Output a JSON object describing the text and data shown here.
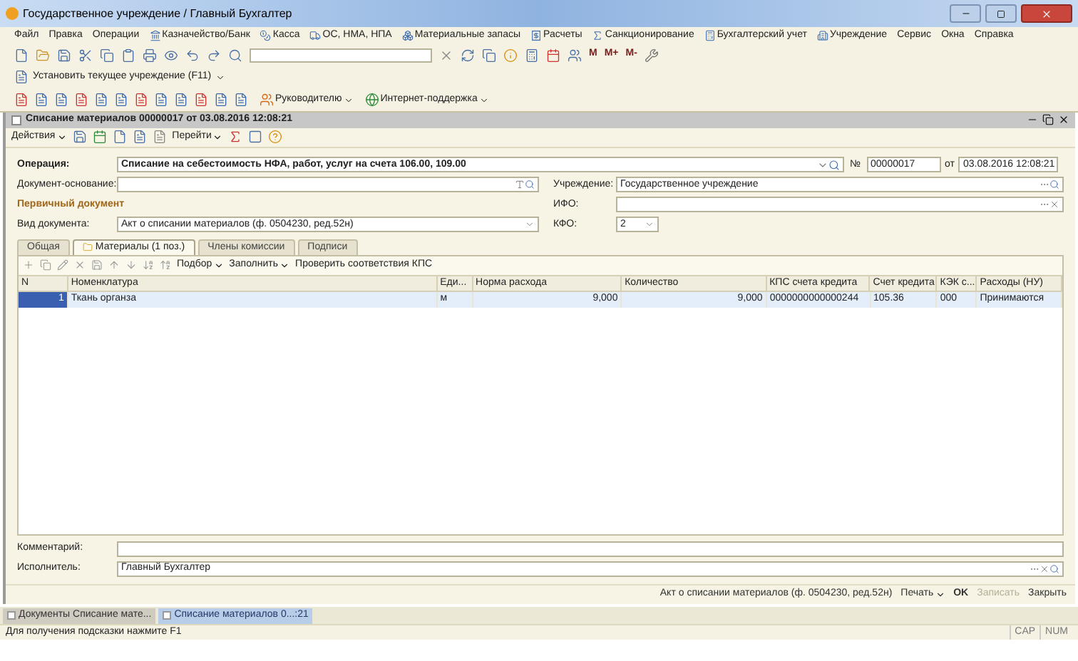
{
  "window": {
    "title": "Государственное учреждение / Главный Бухгалтер"
  },
  "menu": [
    {
      "label": "Файл",
      "kind": "plain"
    },
    {
      "label": "Правка",
      "kind": "plain"
    },
    {
      "label": "Операции",
      "kind": "plain"
    },
    {
      "label": "Казначейство/Банк",
      "kind": "icon"
    },
    {
      "label": "Касса",
      "kind": "icon"
    },
    {
      "label": "ОС, НМА, НПА",
      "kind": "icon"
    },
    {
      "label": "Материальные запасы",
      "kind": "icon"
    },
    {
      "label": "Расчеты",
      "kind": "icon"
    },
    {
      "label": "Санкционирование",
      "kind": "icon"
    },
    {
      "label": "Бухгалтерский учет",
      "kind": "icon"
    },
    {
      "label": "Учреждение",
      "kind": "icon"
    },
    {
      "label": "Сервис",
      "kind": "plain"
    },
    {
      "label": "Окна",
      "kind": "plain"
    },
    {
      "label": "Справка",
      "kind": "plain"
    }
  ],
  "toolbar_1": {
    "memory_buttons": [
      "M",
      "M+",
      "M-"
    ]
  },
  "toolbar_2": {
    "label": "Установить текущее учреждение (F11)"
  },
  "toolbar_3": {
    "items": [
      "Руководителю",
      "Интернет-поддержка"
    ]
  },
  "document": {
    "title": "Списание материалов 00000017 от 03.08.2016 12:08:21",
    "actions": [
      "Действия",
      "Перейти"
    ],
    "operation": {
      "label": "Операция:",
      "value": "Списание на себестоимость НФА, работ, услуг на счета 106.00, 109.00"
    },
    "number": {
      "label": "№",
      "value": "00000017"
    },
    "date": {
      "label": "от",
      "value": "03.08.2016 12:08:21"
    },
    "basis": {
      "label": "Документ-основание:"
    },
    "institution": {
      "label": "Учреждение:",
      "value": "Государственное учреждение"
    },
    "ifo": {
      "label": "ИФО:"
    },
    "section": "Первичный документ",
    "kfo": {
      "label": "КФО:",
      "value": "2"
    },
    "doc_type": {
      "label": "Вид документа:",
      "value": "Акт о списании материалов (ф. 0504230, ред.52н)"
    },
    "tabs": [
      {
        "label": "Общая",
        "selected": false
      },
      {
        "label": "Материалы (1 поз.)",
        "selected": true
      },
      {
        "label": "Члены комиссии",
        "selected": false
      },
      {
        "label": "Подписи",
        "selected": false
      }
    ],
    "table_toolbar": [
      "Подбор",
      "Заполнить",
      "Проверить соответствия КПС"
    ],
    "table": {
      "columns": [
        "N",
        "Номенклатура",
        "Еди...",
        "Норма расхода",
        "Количество",
        "КПС счета кредита",
        "Счет кредита",
        "КЭК с...",
        "Расходы (НУ)"
      ],
      "rows": [
        {
          "selected": true,
          "cells": [
            "1",
            "Ткань органза",
            "м",
            "9,000",
            "9,000",
            "0000000000000244",
            "105.36",
            "000",
            "Принимаются"
          ]
        }
      ]
    },
    "comment": {
      "label": "Комментарий:"
    },
    "executor": {
      "label": "Исполнитель:",
      "value": "Главный Бухгалтер"
    },
    "footer": [
      {
        "label": "Акт о списании материалов (ф. 0504230, ред.52н)",
        "kind": "print-form",
        "disabled": false
      },
      {
        "label": "Печать",
        "kind": "menu",
        "disabled": false
      },
      {
        "label": "OK",
        "kind": "primary",
        "disabled": false
      },
      {
        "label": "Записать",
        "kind": "plain",
        "disabled": true
      },
      {
        "label": "Закрыть",
        "kind": "plain",
        "disabled": false
      }
    ]
  },
  "taskbar": [
    {
      "label": "Документы Списание мате...",
      "selected": false
    },
    {
      "label": "Списание материалов 0...:21",
      "selected": true
    }
  ],
  "status_bar": {
    "hint": "Для получения подсказки нажмите F1",
    "indicators": [
      "CAP",
      "NUM"
    ]
  }
}
